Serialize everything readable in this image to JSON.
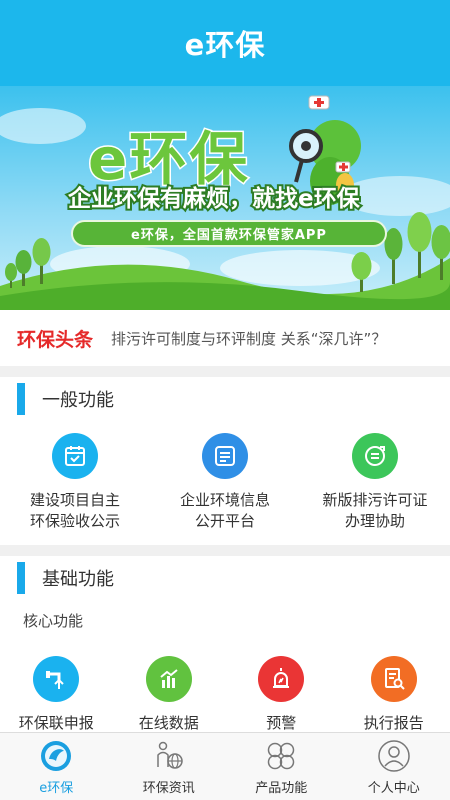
{
  "header": {
    "title": "e环保"
  },
  "banner": {
    "logo_text": "e环保",
    "slogan": "企业环保有麻烦，就找e环保",
    "tagline": "e环保，全国首款环保管家APP"
  },
  "news": {
    "tag": "环保头条",
    "headline": "排污许可制度与环评制度 关系“深几许”？"
  },
  "general_section": {
    "title": "一般功能",
    "items": [
      {
        "label_line1": "建设项目自主",
        "label_line2": "环保验收公示",
        "icon": "calendar-check-icon"
      },
      {
        "label_line1": "企业环境信息",
        "label_line2": "公开平台",
        "icon": "document-list-icon"
      },
      {
        "label_line1": "新版排污许可证",
        "label_line2": "办理协助",
        "icon": "list-arrow-icon"
      }
    ]
  },
  "basic_section": {
    "title": "基础功能",
    "subtitle": "核心功能",
    "items": [
      {
        "label": "环保联申报",
        "icon": "upload-pipe-icon"
      },
      {
        "label": "在线数据",
        "icon": "bar-chart-icon"
      },
      {
        "label": "预警",
        "icon": "alarm-icon"
      },
      {
        "label": "执行报告",
        "icon": "report-search-icon"
      }
    ]
  },
  "tabbar": {
    "tabs": [
      {
        "label": "e环保",
        "icon": "home-leaf-icon",
        "active": true
      },
      {
        "label": "环保资讯",
        "icon": "person-globe-icon",
        "active": false
      },
      {
        "label": "产品功能",
        "icon": "clover-icon",
        "active": false
      },
      {
        "label": "个人中心",
        "icon": "user-icon",
        "active": false
      }
    ]
  },
  "colors": {
    "brand": "#1cb7ec",
    "accent_green": "#6cc63c",
    "headline_red": "#e52a2a",
    "active_tab": "#1a9fe0"
  }
}
